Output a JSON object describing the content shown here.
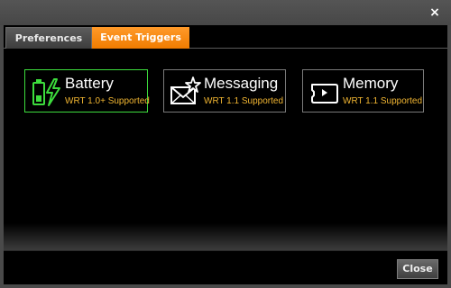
{
  "titlebar": {
    "close_symbol": "×"
  },
  "tabs": [
    {
      "label": "Preferences"
    },
    {
      "label": "Event Triggers"
    }
  ],
  "triggers": [
    {
      "title": "Battery",
      "subtitle": "WRT 1.0+ Supported",
      "icon": "battery-charging-icon"
    },
    {
      "title": "Messaging",
      "subtitle": "WRT 1.1 Supported",
      "icon": "envelope-star-icon"
    },
    {
      "title": "Memory",
      "subtitle": "WRT 1.1 Supported",
      "icon": "memory-card-icon"
    }
  ],
  "footer": {
    "close_label": "Close"
  },
  "colors": {
    "active_tab": "#f07c00",
    "active_border": "#3ddc3d",
    "subtitle": "#f2b632"
  }
}
